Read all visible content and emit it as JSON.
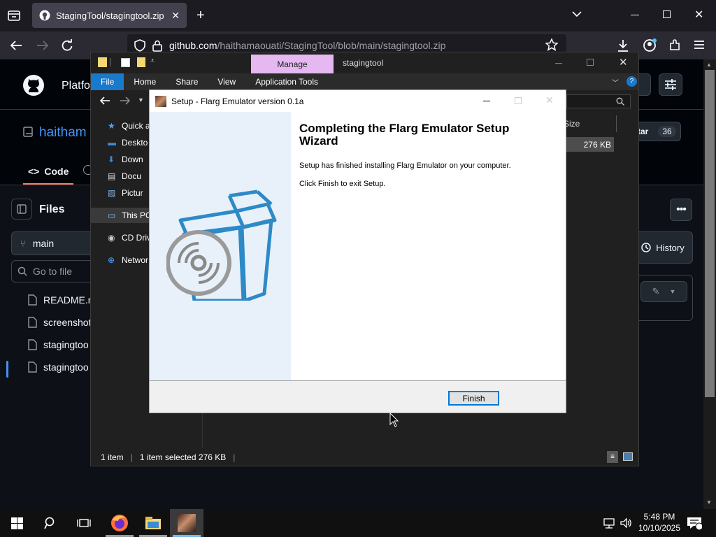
{
  "browser": {
    "tab_title": "StagingTool/stagingtool.zip at m",
    "url_domain": "github.com",
    "url_path": "/haithamaouati/StagingTool/blob/main/stagingtool.zip"
  },
  "github": {
    "platform_label": "Platfo",
    "repo_owner": "haitham",
    "tab_code": "Code",
    "star_label": "tar",
    "star_count": "36",
    "files_title": "Files",
    "branch": "main",
    "go_to_file_placeholder": "Go to file",
    "history": "History",
    "files": [
      "README.m",
      "screenshot",
      "stagingtoo",
      "stagingtoo"
    ]
  },
  "explorer": {
    "manage": "Manage",
    "title": "stagingtool",
    "ribbon": [
      "File",
      "Home",
      "Share",
      "View",
      "Application Tools"
    ],
    "column_size": "Size",
    "file_size": "276 KB",
    "sidebar": [
      "Quick a",
      "Deskto",
      "Down",
      "Docu",
      "Pictur",
      "This PC",
      "CD Driv",
      "Networ"
    ],
    "status": {
      "items": "1 item",
      "selected": "1 item selected  276 KB"
    }
  },
  "setup": {
    "title": "Setup - Flarg Emulator version 0.1a",
    "heading": "Completing the Flarg Emulator Setup Wizard",
    "line1": "Setup has finished installing Flarg Emulator on your computer.",
    "line2": "Click Finish to exit Setup.",
    "finish": "Finish"
  },
  "taskbar": {
    "time": "5:48 PM",
    "date": "10/10/2025"
  },
  "colors": {
    "accent_blue": "#1979ca",
    "manage_tab": "#e5b8f2",
    "github_bg": "#0d1117",
    "box_icon": "#2d8ac7"
  }
}
